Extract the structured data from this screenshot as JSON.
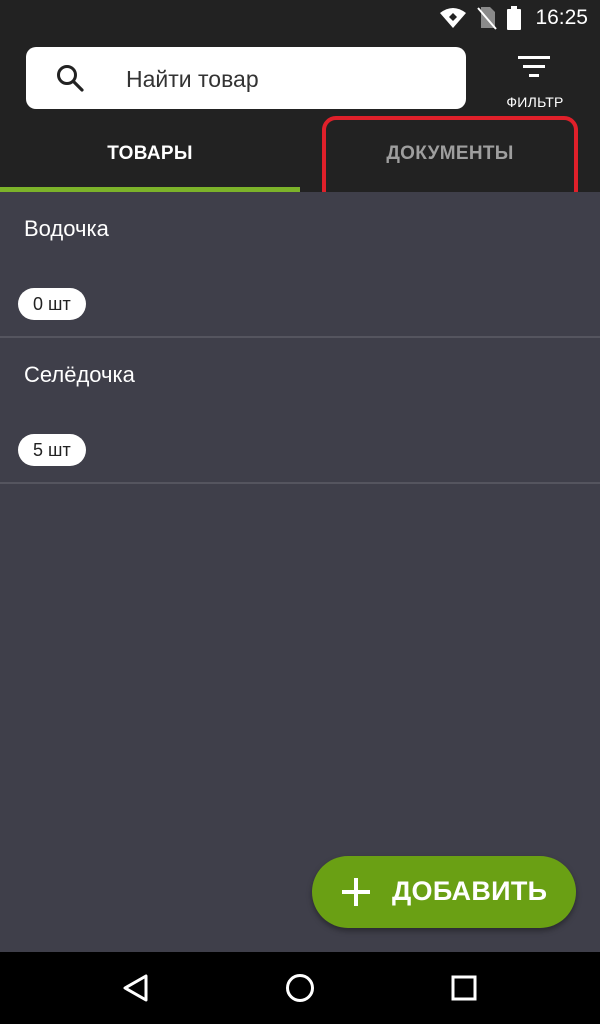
{
  "status_bar": {
    "time": "16:25",
    "icons": [
      "wifi-icon",
      "no-sim-icon",
      "battery-icon"
    ]
  },
  "search": {
    "placeholder": "Найти товар"
  },
  "filter": {
    "label": "ФИЛЬТР"
  },
  "tabs": [
    {
      "label": "ТОВАРЫ",
      "active": true
    },
    {
      "label": "ДОКУМЕНТЫ",
      "active": false
    }
  ],
  "items": [
    {
      "name": "Водочка",
      "quantity": "0 шт"
    },
    {
      "name": "Селёдочка",
      "quantity": "5 шт"
    }
  ],
  "fab": {
    "label": "ДОБАВИТЬ"
  },
  "colors": {
    "background": "#222222",
    "list_background": "#3f3f4a",
    "accent": "#7cb32a",
    "fab": "#6aa014",
    "highlight": "#e0202a"
  }
}
